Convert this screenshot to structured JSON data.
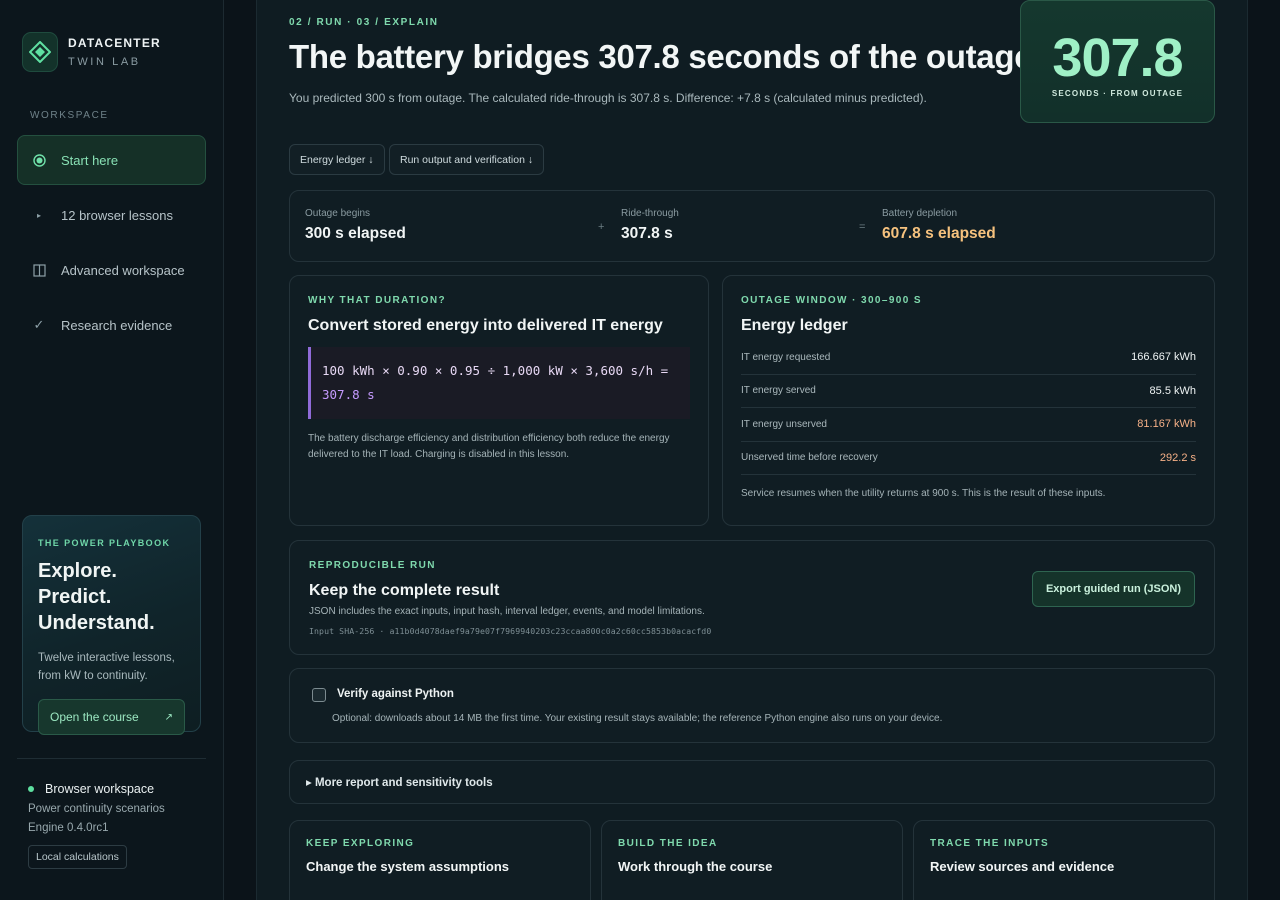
{
  "brand": {
    "name": "DATACENTER",
    "sub": "TWIN LAB",
    "logo_icon": "diamond-logo-icon"
  },
  "sidebar": {
    "section_label": "WORKSPACE",
    "items": [
      {
        "label": "Start here",
        "icon": "target-icon",
        "active": true
      },
      {
        "label": "12 browser lessons",
        "icon": "play-icon",
        "active": false
      },
      {
        "label": "Advanced workspace",
        "icon": "panels-icon",
        "active": false
      },
      {
        "label": "Research evidence",
        "icon": "checkmark-icon",
        "active": false
      }
    ],
    "promo": {
      "kicker": "THE POWER PLAYBOOK",
      "title_line1": "Explore. Predict.",
      "title_line2": "Understand.",
      "text_line1": "Twelve interactive lessons,",
      "text_line2": "from kW to continuity.",
      "button_label": "Open the course",
      "button_icon": "↗"
    },
    "status": {
      "title": "Browser workspace",
      "line1": "Power continuity scenarios",
      "line2": "Engine 0.4.0rc1",
      "badge": "Local calculations"
    }
  },
  "header": {
    "breadcrumb": "02 / RUN · 03 / EXPLAIN",
    "headline": "The battery bridges 307.8 seconds of the outage.",
    "subline": "You predicted 300 s from outage. The calculated ride-through is 307.8 s. Difference: +7.8 s (calculated minus predicted).",
    "big_value": "307.8",
    "big_label": "SECONDS · FROM OUTAGE"
  },
  "chips": [
    {
      "label": "Energy ledger ↓"
    },
    {
      "label": "Run output and verification ↓"
    }
  ],
  "timeline": {
    "items": [
      {
        "label": "Outage begins",
        "value": "300 s elapsed"
      },
      {
        "label": "Ride-through",
        "value": "307.8 s"
      },
      {
        "label": "Battery depletion",
        "value": "607.8 s elapsed"
      }
    ],
    "op_plus": "+",
    "op_equals": "="
  },
  "why": {
    "kicker": "WHY THAT DURATION?",
    "title": "Convert stored energy into delivered IT energy",
    "formula_line1": "100 kWh × 0.90 × 0.95 ÷ 1,000 kW × 3,600 s/h =",
    "formula_result": "307.8 s",
    "note": "The battery discharge efficiency and distribution efficiency both reduce the energy delivered to the IT load. Charging is disabled in this lesson."
  },
  "ledger": {
    "kicker": "OUTAGE WINDOW · 300–900 S",
    "title": "Energy ledger",
    "rows": [
      {
        "key": "IT energy requested",
        "value": "166.667 kWh",
        "warn": false
      },
      {
        "key": "IT energy served",
        "value": "85.5 kWh",
        "warn": false
      },
      {
        "key": "IT energy unserved",
        "value": "81.167 kWh",
        "warn": true
      },
      {
        "key": "Unserved time before recovery",
        "value": "292.2 s",
        "warn": true
      }
    ],
    "footer": "Service resumes when the utility returns at 900 s. This is the result of these inputs."
  },
  "repro": {
    "kicker": "REPRODUCIBLE RUN",
    "title": "Keep the complete result",
    "text": "JSON includes the exact inputs, input hash, interval ledger, events, and model limitations.",
    "hash": "Input SHA-256 · a11b0d4078daef9a79e07f7969940203c23ccaa800c0a2c60cc5853b0acacfd0",
    "button": "Export guided run (JSON)"
  },
  "verify": {
    "label": "Verify against Python",
    "note": "Optional: downloads about 14 MB the first time. Your existing result stays available; the reference Python engine also runs on your device."
  },
  "more": {
    "summary": "▸ More report and sensitivity tools"
  },
  "bottom_cards": [
    {
      "kicker": "KEEP EXPLORING",
      "title": "Change the system assumptions"
    },
    {
      "kicker": "BUILD THE IDEA",
      "title": "Work through the course"
    },
    {
      "kicker": "TRACE THE INPUTS",
      "title": "Review sources and evidence"
    }
  ],
  "colors": {
    "accent": "#7fd9ad",
    "warn": "#f5b087",
    "formula": "#c59bff"
  }
}
